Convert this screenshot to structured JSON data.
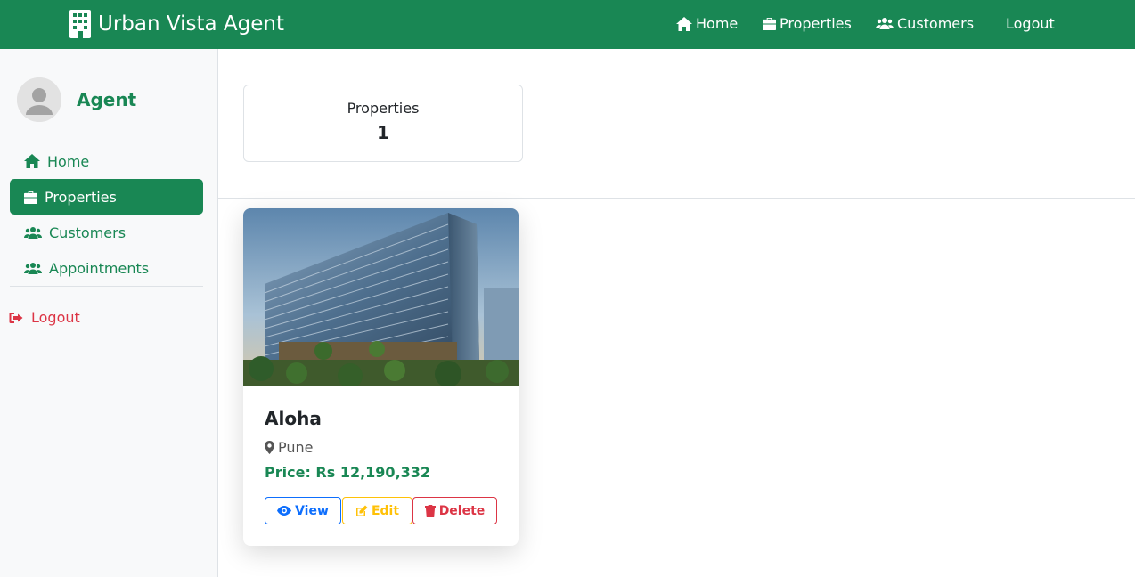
{
  "navbar": {
    "brand": "Urban Vista Agent",
    "brand_icon": "building-icon",
    "links": [
      {
        "label": "Home",
        "icon": "home-icon"
      },
      {
        "label": "Properties",
        "icon": "briefcase-icon"
      },
      {
        "label": "Customers",
        "icon": "users-icon"
      },
      {
        "label": "Logout"
      }
    ],
    "color": "#198754"
  },
  "sidebar": {
    "agent_name": "Agent",
    "items": [
      {
        "label": "Home",
        "icon": "home-icon"
      },
      {
        "label": "Properties",
        "icon": "briefcase-icon",
        "active": true
      },
      {
        "label": "Customers",
        "icon": "users-icon"
      },
      {
        "label": "Appointments",
        "icon": "users-icon"
      }
    ],
    "logout": {
      "label": "Logout",
      "icon": "sign-out-icon"
    }
  },
  "stats": {
    "title": "Properties",
    "value": "1"
  },
  "properties": [
    {
      "name": "Aloha",
      "location": "Pune",
      "price": "Price: Rs 12,190,332",
      "buttons": {
        "view": "View",
        "edit": "Edit",
        "delete": "Delete"
      }
    }
  ],
  "colors": {
    "primary": "#198754",
    "view": "#0d6efd",
    "edit": "#ffc107",
    "delete": "#dc3545"
  }
}
